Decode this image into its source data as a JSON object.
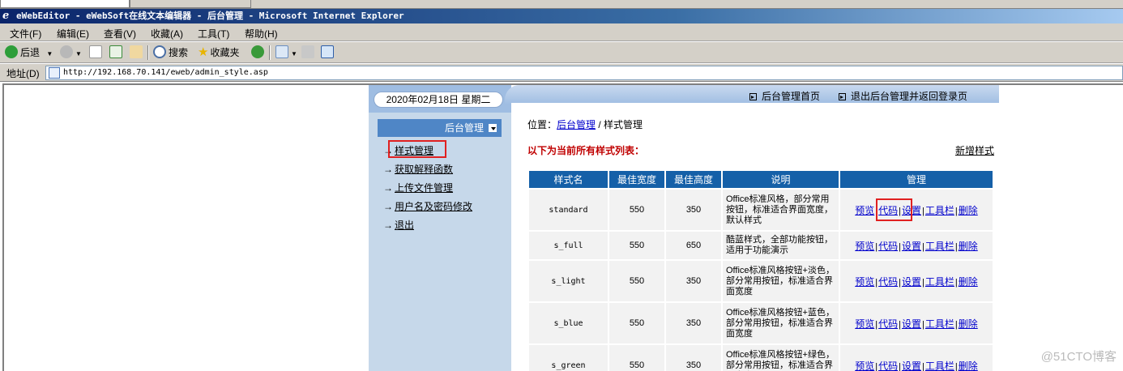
{
  "window": {
    "title": "eWebEditor - eWebSoft在线文本编辑器 - 后台管理 - Microsoft Internet Explorer"
  },
  "menu": [
    "文件(F)",
    "编辑(E)",
    "查看(V)",
    "收藏(A)",
    "工具(T)",
    "帮助(H)"
  ],
  "toolbar": {
    "back": "后退",
    "search": "搜索",
    "favorites": "收藏夹"
  },
  "address": {
    "label": "地址(D)",
    "url": "http://192.168.70.141/eweb/admin_style.asp"
  },
  "header": {
    "date": "2020年02月18日 星期二",
    "home_link": "后台管理首页",
    "logout_link": "退出后台管理并返回登录页"
  },
  "sidebar": {
    "title": "后台管理",
    "items": [
      {
        "label": "样式管理"
      },
      {
        "label": "获取解释函数"
      },
      {
        "label": "上传文件管理"
      },
      {
        "label": "用户名及密码修改"
      },
      {
        "label": "退出"
      }
    ]
  },
  "main": {
    "location_prefix": "位置：",
    "location_link": "后台管理",
    "location_sep": " / ",
    "location_current": "样式管理",
    "list_title": "以下为当前所有样式列表：",
    "new_style": "新增样式",
    "columns": [
      "样式名",
      "最佳宽度",
      "最佳高度",
      "说明",
      "管理"
    ],
    "actions": [
      "预览",
      "代码",
      "设置",
      "工具栏",
      "删除"
    ],
    "rows": [
      {
        "name": "standard",
        "width": "550",
        "height": "350",
        "desc": "Office标准风格，部分常用按钮，标准适合界面宽度，默认样式"
      },
      {
        "name": "s_full",
        "width": "550",
        "height": "650",
        "desc": "酷蓝样式，全部功能按钮，适用于功能演示"
      },
      {
        "name": "s_light",
        "width": "550",
        "height": "350",
        "desc": "Office标准风格按钮+淡色，部分常用按钮，标准适合界面宽度"
      },
      {
        "name": "s_blue",
        "width": "550",
        "height": "350",
        "desc": "Office标准风格按钮+蓝色，部分常用按钮，标准适合界面宽度"
      },
      {
        "name": "s_green",
        "width": "550",
        "height": "350",
        "desc": "Office标准风格按钮+绿色，部分常用按钮，标准适合界面宽度"
      }
    ]
  },
  "watermark": "@51CTO博客",
  "colors": {
    "header_blue": "#1560a8",
    "sidebar_bg": "#c6d8ea",
    "highlight_red": "#e02020",
    "title_red": "#c00000"
  }
}
